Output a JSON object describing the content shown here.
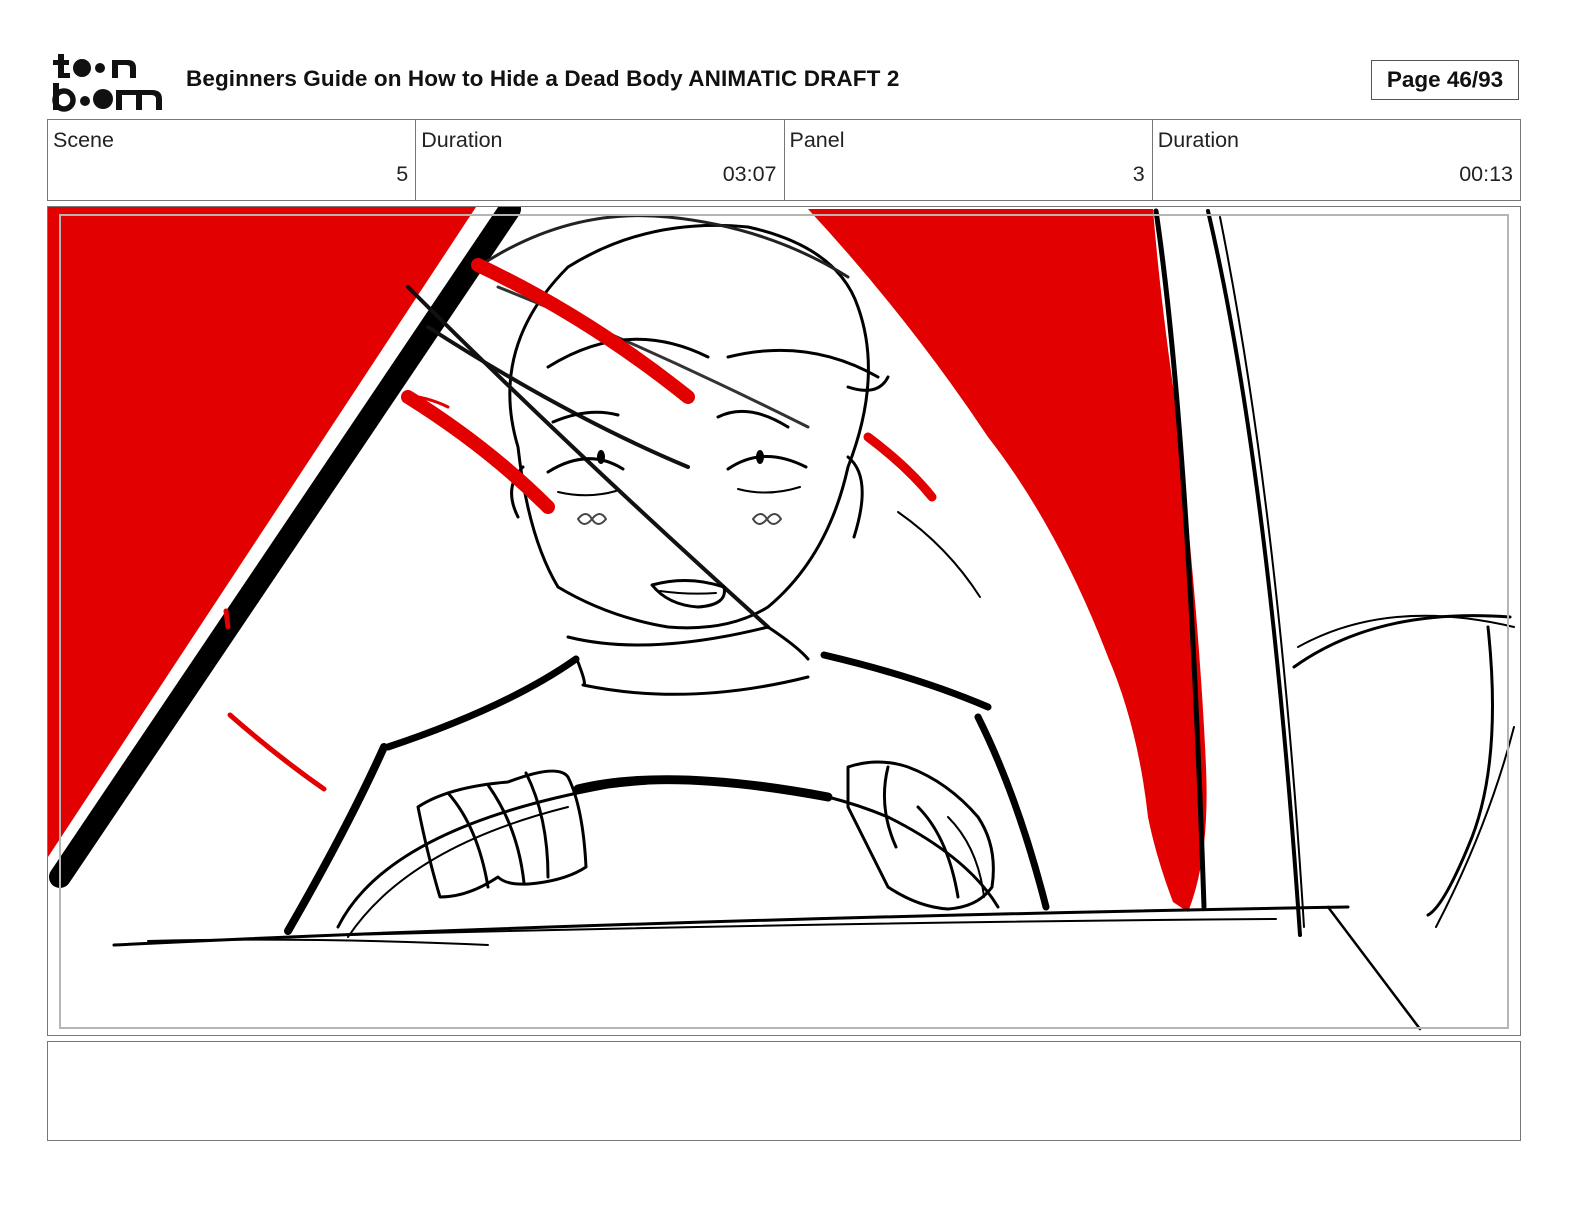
{
  "header": {
    "logo_text": "toon boom",
    "title": "Beginners Guide on How to Hide a Dead Body ANIMATIC DRAFT 2",
    "page_label": "Page 46/93"
  },
  "info": {
    "scene_label": "Scene",
    "scene_value": "5",
    "scene_duration_label": "Duration",
    "scene_duration_value": "03:07",
    "panel_label": "Panel",
    "panel_value": "3",
    "panel_duration_label": "Duration",
    "panel_duration_value": "00:13"
  },
  "panel": {
    "description": "",
    "colors": {
      "accent_red": "#e30000",
      "ink": "#000000"
    }
  },
  "notes": {
    "text": ""
  }
}
